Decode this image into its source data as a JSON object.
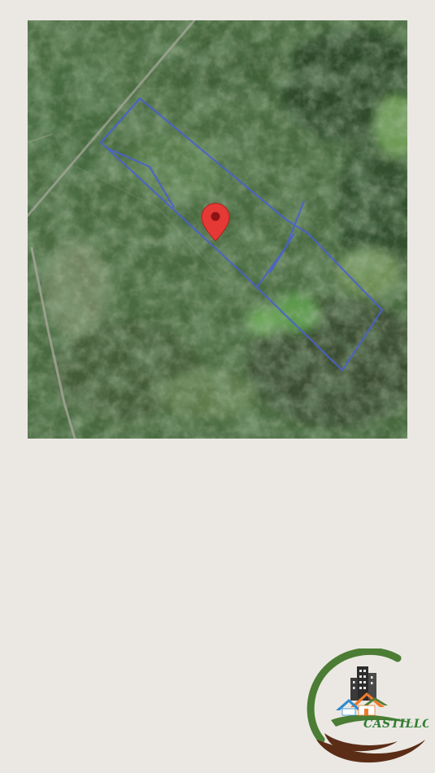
{
  "map": {
    "type": "satellite",
    "marker_icon": "map-pin-icon",
    "colors": {
      "parcel_outline": "#4a5fd0",
      "marker": "#e53935",
      "road": "#a9aa9c"
    }
  },
  "logo": {
    "brand_name": "CASTILLO",
    "icon": "house-buildings-logo",
    "colors": {
      "ring": "#4b7d34",
      "swoosh": "#5b2d17",
      "text": "#2e7d32",
      "roof_orange": "#ef7a2c",
      "roof_blue": "#2f8bd0"
    }
  }
}
